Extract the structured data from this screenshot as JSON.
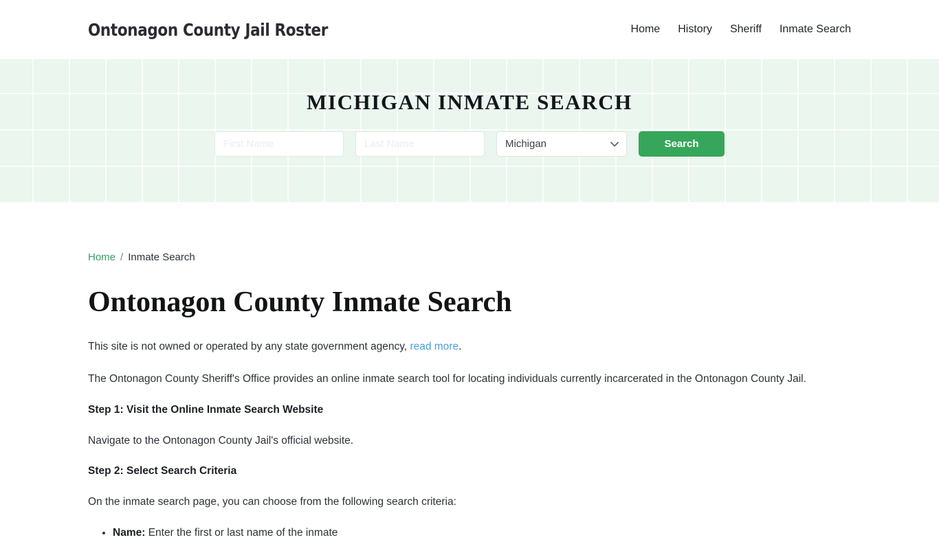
{
  "header": {
    "site_title": "Ontonagon County Jail Roster",
    "nav": [
      {
        "label": "Home"
      },
      {
        "label": "History"
      },
      {
        "label": "Sheriff"
      },
      {
        "label": "Inmate Search"
      }
    ]
  },
  "hero": {
    "title": "Michigan Inmate Search",
    "first_name_placeholder": "First Name",
    "first_name_value": "",
    "last_name_placeholder": "Last Name",
    "last_name_value": "",
    "state_selected": "Michigan",
    "search_button": "Search",
    "accent_color": "#36a65a",
    "background_color": "#eaf6ee"
  },
  "breadcrumb": {
    "home": "Home",
    "separator": "/",
    "current": "Inmate Search",
    "link_color": "#3b9c63"
  },
  "main": {
    "page_title": "Ontonagon County Inmate Search",
    "disclaimer_text": "This site is not owned or operated by any state government agency,",
    "disclaimer_link": "read more",
    "disclaimer_end": ".",
    "intro_paragraph": "The Ontonagon County Sheriff's Office provides an online inmate search tool for locating individuals currently incarcerated in the Ontonagon County Jail.",
    "step1_heading": "Step 1: Visit the Online Inmate Search Website",
    "step1_text": "Navigate to the Ontonagon County Jail's official website.",
    "step2_heading": "Step 2: Select Search Criteria",
    "step2_text": "On the inmate search page, you can choose from the following search criteria:",
    "criteria": [
      {
        "label": "Name:",
        "description": "Enter the first or last name of the inmate"
      }
    ]
  }
}
